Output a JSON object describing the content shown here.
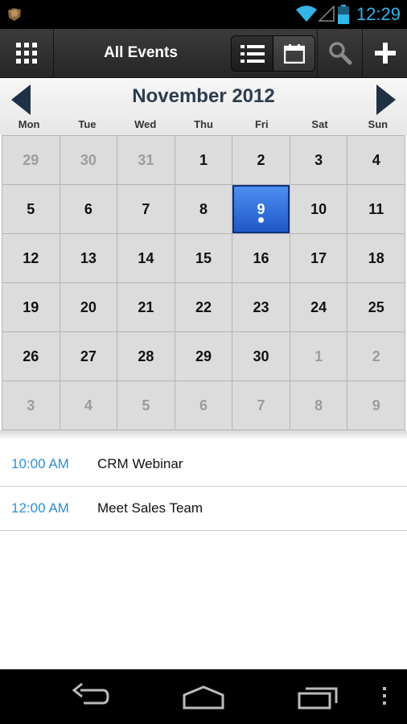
{
  "status_bar": {
    "time": "12:29",
    "icons": [
      "app-icon",
      "wifi-icon",
      "signal-icon",
      "battery-icon"
    ]
  },
  "action_bar": {
    "title": "All Events",
    "icons": [
      "grid-icon",
      "list-view-icon",
      "calendar-view-icon",
      "search-icon",
      "add-icon"
    ]
  },
  "calendar": {
    "month_title": "November 2012",
    "weekdays": [
      "Mon",
      "Tue",
      "Wed",
      "Thu",
      "Fri",
      "Sat",
      "Sun"
    ],
    "days": [
      {
        "n": "29",
        "other": true
      },
      {
        "n": "30",
        "other": true
      },
      {
        "n": "31",
        "other": true
      },
      {
        "n": "1"
      },
      {
        "n": "2"
      },
      {
        "n": "3"
      },
      {
        "n": "4"
      },
      {
        "n": "5"
      },
      {
        "n": "6"
      },
      {
        "n": "7"
      },
      {
        "n": "8"
      },
      {
        "n": "9",
        "selected": true,
        "has_events": true
      },
      {
        "n": "10"
      },
      {
        "n": "11"
      },
      {
        "n": "12"
      },
      {
        "n": "13"
      },
      {
        "n": "14"
      },
      {
        "n": "15"
      },
      {
        "n": "16"
      },
      {
        "n": "17"
      },
      {
        "n": "18"
      },
      {
        "n": "19"
      },
      {
        "n": "20"
      },
      {
        "n": "21"
      },
      {
        "n": "22"
      },
      {
        "n": "23"
      },
      {
        "n": "24"
      },
      {
        "n": "25"
      },
      {
        "n": "26"
      },
      {
        "n": "27"
      },
      {
        "n": "28"
      },
      {
        "n": "29"
      },
      {
        "n": "30"
      },
      {
        "n": "1",
        "other": true
      },
      {
        "n": "2",
        "other": true
      },
      {
        "n": "3",
        "other": true
      },
      {
        "n": "4",
        "other": true
      },
      {
        "n": "5",
        "other": true
      },
      {
        "n": "6",
        "other": true
      },
      {
        "n": "7",
        "other": true
      },
      {
        "n": "8",
        "other": true
      },
      {
        "n": "9",
        "other": true
      }
    ]
  },
  "events": [
    {
      "time": "10:00 AM",
      "title": "CRM Webinar"
    },
    {
      "time": "12:00 AM",
      "title": "Meet Sales Team"
    }
  ],
  "nav_bar": {
    "icons": [
      "back-icon",
      "home-icon",
      "recent-apps-icon",
      "menu-icon"
    ]
  },
  "colors": {
    "accent": "#33b5e5",
    "selected_day": "#2a6ad8",
    "event_time": "#2f8fd2",
    "month_title": "#2c3d4f"
  }
}
